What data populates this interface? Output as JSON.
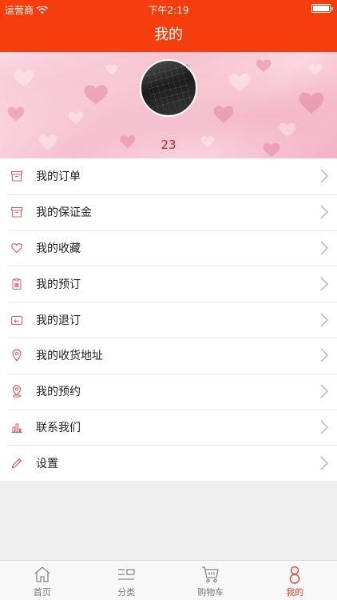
{
  "status_bar": {
    "carrier": "运营商",
    "time": "下午2:19"
  },
  "nav": {
    "title": "我的"
  },
  "profile": {
    "count": "23"
  },
  "menu": [
    {
      "label": "我的订单",
      "icon": "box-icon"
    },
    {
      "label": "我的保证金",
      "icon": "archive-icon"
    },
    {
      "label": "我的收藏",
      "icon": "heart-icon"
    },
    {
      "label": "我的预订",
      "icon": "clipboard-icon"
    },
    {
      "label": "我的退订",
      "icon": "return-icon"
    },
    {
      "label": "我的收货地址",
      "icon": "location-pin-icon"
    },
    {
      "label": "我的预约",
      "icon": "location-pin-icon"
    },
    {
      "label": "联系我们",
      "icon": "chart-icon"
    },
    {
      "label": "设置",
      "icon": "pencil-icon"
    }
  ],
  "tabs": [
    {
      "label": "首页",
      "icon": "home-icon",
      "active": false
    },
    {
      "label": "分类",
      "icon": "category-icon",
      "active": false
    },
    {
      "label": "购物车",
      "icon": "cart-icon",
      "active": false
    },
    {
      "label": "我的",
      "icon": "person-icon",
      "active": true
    }
  ],
  "colors": {
    "brand": "#f53d0d",
    "accent": "#e8402a",
    "count": "#c5282d",
    "icon": "#e85a5a"
  }
}
